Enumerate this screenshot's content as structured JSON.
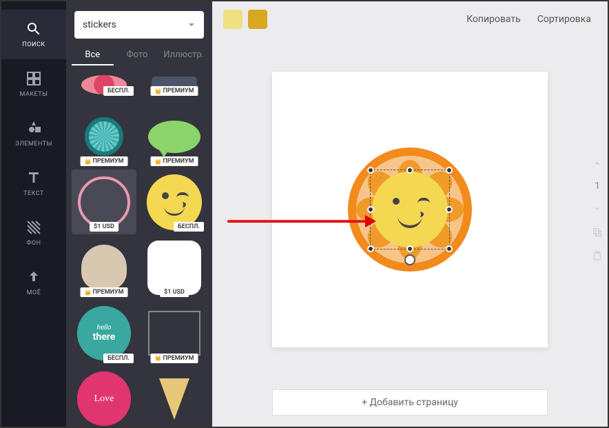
{
  "toolbar": {
    "search": "ПОИСК",
    "layouts": "МАКЕТЫ",
    "elements": "ЭЛЕМЕНТЫ",
    "text": "ТЕКСТ",
    "background": "ФОН",
    "mine": "МОЁ"
  },
  "search": {
    "value": "stickers"
  },
  "tabs": {
    "all": "Все",
    "photo": "Фото",
    "illustr": "Иллюстр."
  },
  "badges": {
    "free": "БЕСПЛ.",
    "premium": "ПРЕМИУМ",
    "usd1": "$1 USD"
  },
  "topbar": {
    "copy": "Копировать",
    "sort": "Сортировка"
  },
  "hello": {
    "line1": "hello",
    "line2": "there"
  },
  "love": "Love",
  "addPage": "+ Добавить страницу",
  "pageNumber": "1",
  "colors": {
    "swatch1": "#f0e080",
    "swatch2": "#d9a820"
  }
}
